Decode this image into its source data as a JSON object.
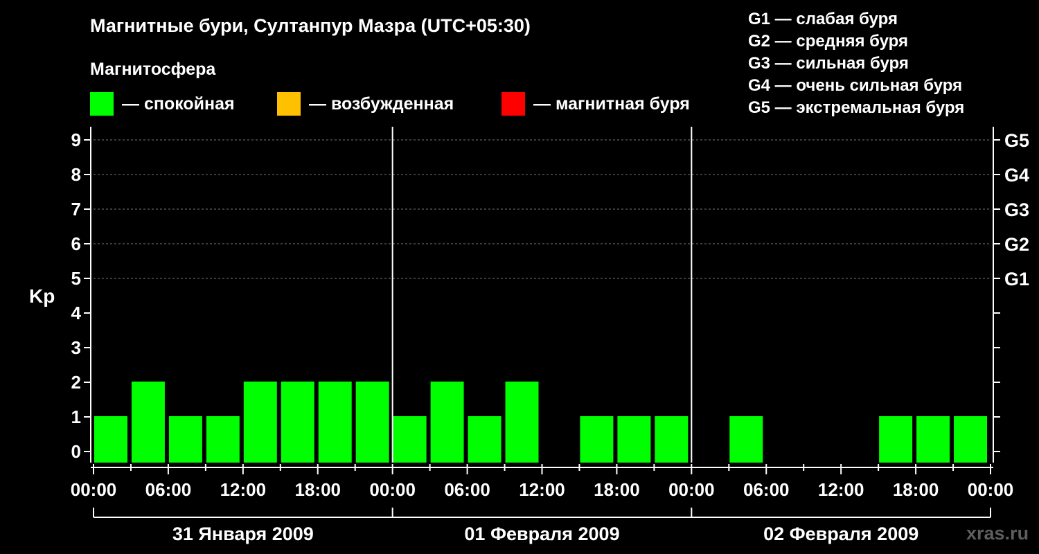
{
  "title": "Магнитные бури, Султанпур Мазра (UTC+05:30)",
  "subtitle": "Магнитосфера",
  "legend": [
    {
      "label": "— спокойная",
      "color": "#00ff00"
    },
    {
      "label": "— возбужденная",
      "color": "#ffc000"
    },
    {
      "label": "— магнитная буря",
      "color": "#ff0000"
    }
  ],
  "g_legend": [
    "G1 — слабая буря",
    "G2 — средняя буря",
    "G3 — сильная буря",
    "G4 — очень сильная буря",
    "G5 — экстремальная буря"
  ],
  "watermark": "xras.ru",
  "chart_data": {
    "type": "bar",
    "ylabel": "Kp",
    "ylim": [
      0,
      9
    ],
    "y_ticks": [
      "0",
      "1",
      "2",
      "3",
      "4",
      "5",
      "6",
      "7",
      "8",
      "9"
    ],
    "right_ticks": [
      {
        "kp": 5,
        "label": "G1"
      },
      {
        "kp": 6,
        "label": "G2"
      },
      {
        "kp": 7,
        "label": "G3"
      },
      {
        "kp": 8,
        "label": "G4"
      },
      {
        "kp": 9,
        "label": "G5"
      }
    ],
    "x_tick_labels": [
      "00:00",
      "06:00",
      "12:00",
      "18:00",
      "00:00",
      "06:00",
      "12:00",
      "18:00",
      "00:00",
      "06:00",
      "12:00",
      "18:00",
      "00:00"
    ],
    "days": [
      "31 Января 2009",
      "01 Февраля 2009",
      "02 Февраля 2009"
    ],
    "bar_hours": [
      0,
      3,
      6,
      9,
      12,
      15,
      18,
      21,
      24,
      27,
      30,
      33,
      36,
      39,
      42,
      45,
      48,
      51,
      54,
      57,
      60,
      63,
      66,
      69
    ],
    "values": [
      1,
      2,
      1,
      1,
      2,
      2,
      2,
      2,
      1,
      2,
      1,
      2,
      0,
      1,
      1,
      1,
      0,
      1,
      0,
      0,
      0,
      1,
      1,
      1
    ],
    "bar_color": "#00ff00",
    "grid": true
  }
}
